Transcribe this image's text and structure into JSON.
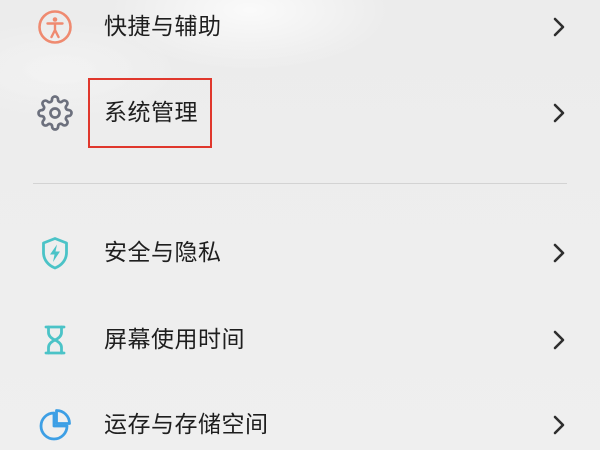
{
  "colors": {
    "background": "#eeeeee",
    "text": "#1e1e1e",
    "chevron": "#2e2e2e",
    "divider": "#d3d3d3",
    "highlight": "#e0372c"
  },
  "menu": {
    "items": [
      {
        "label": "快捷与辅助",
        "icon": "accessibility-icon",
        "icon_color": "#ef8a70",
        "chevron": "chevron-right-icon"
      },
      {
        "label": "系统管理",
        "icon": "gear-icon",
        "icon_color": "#6c707d",
        "chevron": "chevron-right-icon",
        "highlighted": true
      },
      {
        "label": "安全与隐私",
        "icon": "shield-icon",
        "icon_color": "#4bc3c7",
        "chevron": "chevron-right-icon"
      },
      {
        "label": "屏幕使用时间",
        "icon": "hourglass-icon",
        "icon_color": "#4bc3c7",
        "chevron": "chevron-right-icon"
      },
      {
        "label": "运存与存储空间",
        "icon": "pie-chart-icon",
        "icon_color": "#3d9fe5",
        "chevron": "chevron-right-icon"
      }
    ]
  }
}
